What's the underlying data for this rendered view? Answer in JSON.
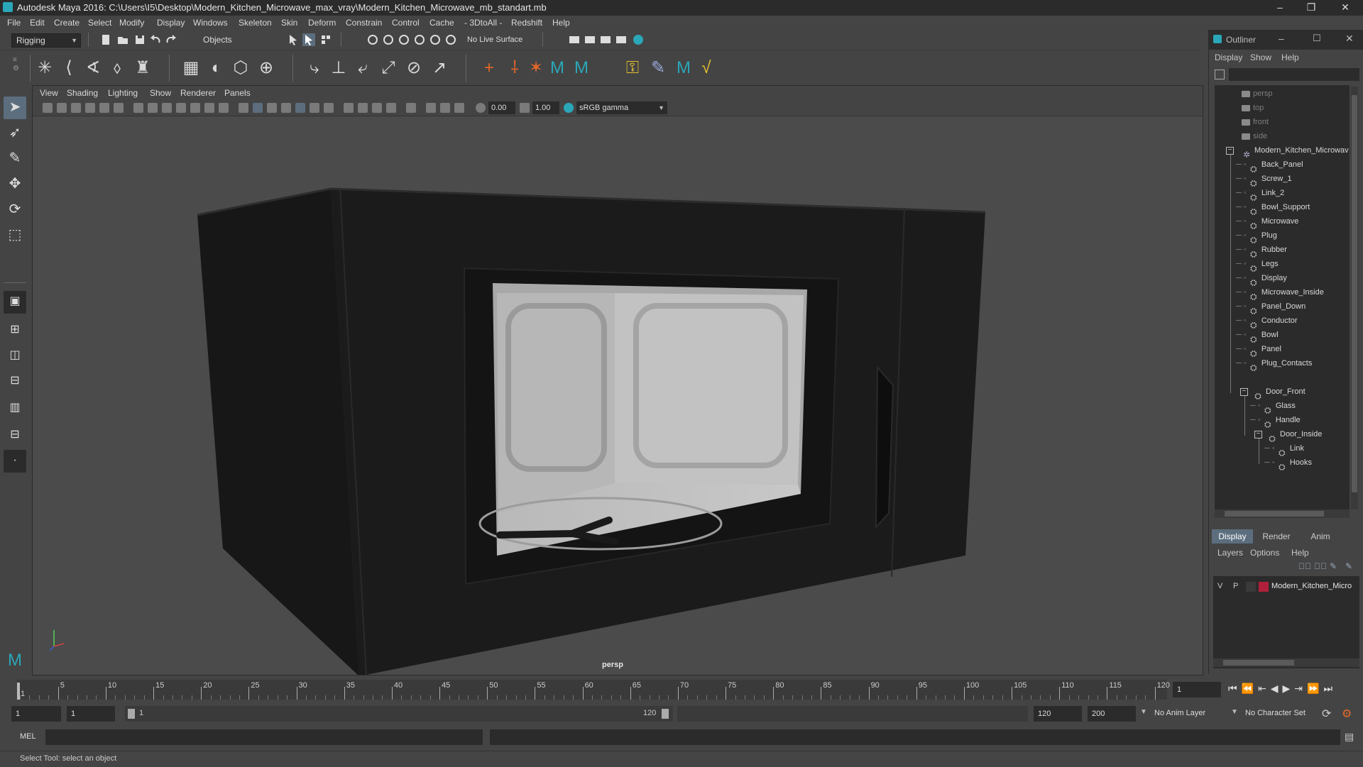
{
  "window": {
    "title": "Autodesk Maya 2016: C:\\Users\\I5\\Desktop\\Modern_Kitchen_Microwave_max_vray\\Modern_Kitchen_Microwave_mb_standart.mb"
  },
  "menubar": [
    "File",
    "Edit",
    "Create",
    "Select",
    "Modify",
    "Display",
    "Windows",
    "Skeleton",
    "Skin",
    "Deform",
    "Constrain",
    "Control",
    "Cache",
    "- 3DtoAll -",
    "Redshift",
    "Help"
  ],
  "statusline": {
    "menuset": "Rigging",
    "selection_mode": "Objects",
    "live_surface": "No Live Surface"
  },
  "viewport": {
    "menus": [
      "View",
      "Shading",
      "Lighting",
      "Show",
      "Renderer",
      "Panels"
    ],
    "exposure": "0.00",
    "gamma": "1.00",
    "color_space": "sRGB gamma",
    "camera_label": "persp"
  },
  "outliner": {
    "title": "Outliner",
    "menus": [
      "Display",
      "Show",
      "Help"
    ],
    "cameras": [
      "persp",
      "top",
      "front",
      "side"
    ],
    "root": "Modern_Kitchen_Microwav",
    "children": [
      "Back_Panel",
      "Screw_1",
      "Link_2",
      "Bowl_Support",
      "Microwave",
      "Plug",
      "Rubber",
      "Legs",
      "Display",
      "Microwave_Inside",
      "Panel_Down",
      "Conductor",
      "Bowl",
      "Panel",
      "Plug_Contacts",
      "Door_Front"
    ],
    "door_front_children": [
      "Glass",
      "Handle",
      "Door_Inside"
    ],
    "door_inside_children": [
      "Link",
      "Hooks"
    ]
  },
  "layer_editor": {
    "tabs": [
      "Display",
      "Render",
      "Anim"
    ],
    "menus": [
      "Layers",
      "Options",
      "Help"
    ],
    "layer": {
      "v": "V",
      "p": "P",
      "name": "Modern_Kitchen_Micro",
      "color": "#b0203a"
    }
  },
  "timeline": {
    "ticks": [
      "5",
      "10",
      "15",
      "20",
      "25",
      "30",
      "35",
      "40",
      "45",
      "50",
      "55",
      "60",
      "65",
      "70",
      "75",
      "80",
      "85",
      "90",
      "95",
      "100",
      "105",
      "110",
      "115",
      "120"
    ],
    "start_label": "1",
    "current_frame": "1"
  },
  "range": {
    "start": "1",
    "playback_start": "1",
    "slider_start": "1",
    "slider_end": "120",
    "playback_end": "120",
    "end": "200",
    "anim_layer": "No Anim Layer",
    "character_set": "No Character Set"
  },
  "command": {
    "language": "MEL"
  },
  "help_line": "Select Tool: select an object",
  "colors": {
    "accent": "#5c6e7e",
    "maya_teal": "#2aa7b8"
  }
}
